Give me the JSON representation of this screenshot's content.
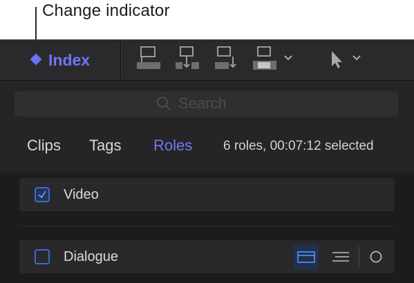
{
  "callout": {
    "text": "Change indicator"
  },
  "toolbar": {
    "index_label": "Index",
    "accent_color": "#6b73f2",
    "buttons": [
      {
        "icon": "connect-clip-icon"
      },
      {
        "icon": "insert-clip-icon"
      },
      {
        "icon": "append-clip-icon"
      },
      {
        "icon": "overwrite-clip-icon"
      },
      {
        "icon": "chevron-down-icon"
      },
      {
        "icon": "select-tool-icon"
      },
      {
        "icon": "chevron-down-icon"
      }
    ]
  },
  "search": {
    "placeholder": "Search",
    "value": ""
  },
  "tabs": [
    {
      "label": "Clips",
      "active": false
    },
    {
      "label": "Tags",
      "active": false
    },
    {
      "label": "Roles",
      "active": true
    }
  ],
  "status": {
    "text": "6 roles, 00:07:12 selected"
  },
  "roles": [
    {
      "label": "Video",
      "checked": true
    },
    {
      "label": "Dialogue",
      "checked": false,
      "controls": [
        "lanes-icon",
        "subroles-icon",
        "focus-circle-icon"
      ]
    }
  ]
}
